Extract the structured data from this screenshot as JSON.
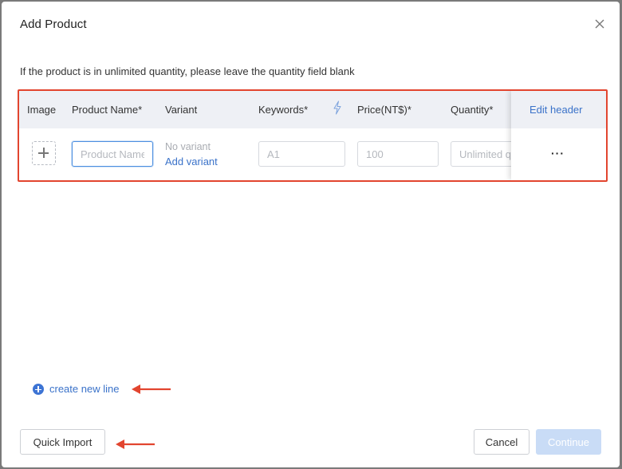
{
  "modal": {
    "title": "Add Product",
    "close_icon": "close-icon",
    "hint": "If the product is in unlimited quantity, please leave the quantity field blank"
  },
  "table": {
    "headers": {
      "image": "Image",
      "product_name": "Product Name*",
      "variant": "Variant",
      "keywords": "Keywords*",
      "price": "Price(NT$)*",
      "quantity": "Quantity*",
      "edit_header": "Edit header"
    },
    "row": {
      "product_name_placeholder": "Product Name",
      "no_variant": "No variant",
      "add_variant": "Add variant",
      "keywords_placeholder": "A1",
      "price_placeholder": "100",
      "quantity_placeholder": "Unlimited quantity",
      "more": "···"
    }
  },
  "actions": {
    "create_new_line": "create new line",
    "quick_import": "Quick Import",
    "cancel": "Cancel",
    "continue": "Continue"
  },
  "colors": {
    "accent": "#3a72c9",
    "annotation_red": "#e2452f",
    "header_bg": "#eef0f5",
    "continue_disabled": "#c9dcf6"
  }
}
